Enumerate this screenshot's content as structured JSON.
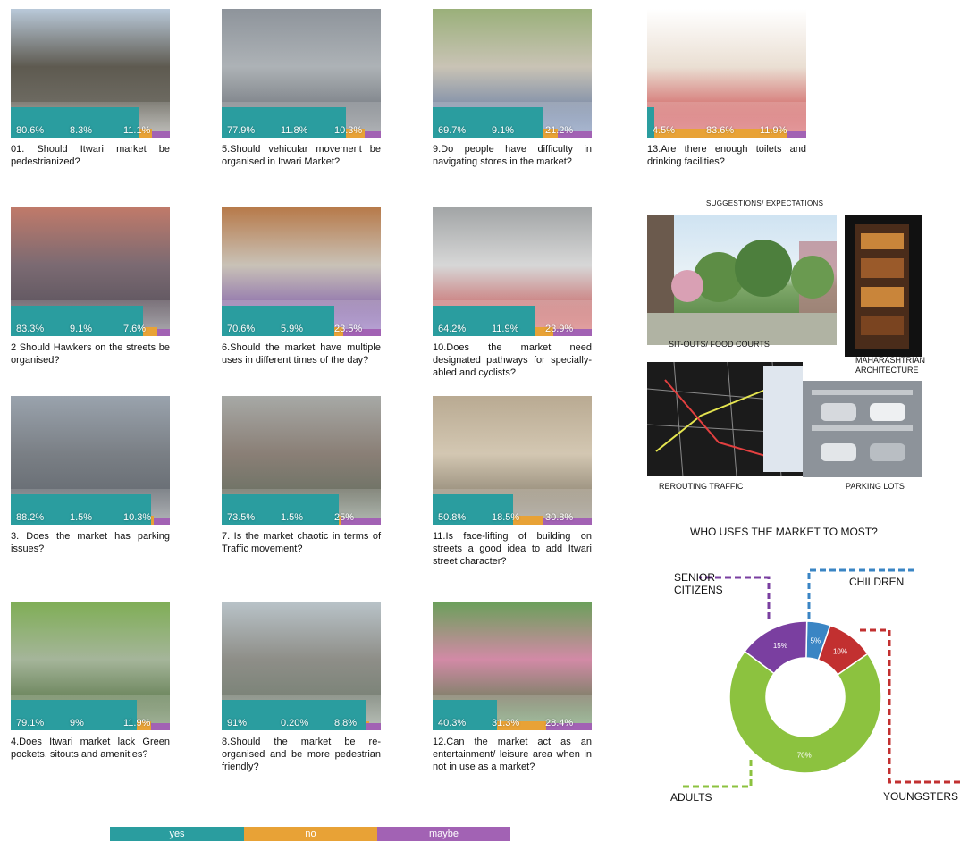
{
  "colors": {
    "yes": "#2a9d9f",
    "no": "#e8a236",
    "maybe": "#a262b4",
    "senior": "#7a3fa0",
    "children": "#3a85c4",
    "youngsters": "#c23030",
    "adults": "#8cc23f"
  },
  "questions": [
    {
      "id": "q1",
      "text": "01. Should Itwari market be pedestrianized?",
      "yes": 80.6,
      "no": 8.3,
      "maybe": 11.1,
      "labels": [
        "80.6%",
        "8.3%",
        "11.1%"
      ]
    },
    {
      "id": "q2",
      "text": "2 Should Hawkers on the streets be organised?",
      "yes": 83.3,
      "no": 9.1,
      "maybe": 7.6,
      "labels": [
        "83.3%",
        "9.1%",
        "7.6%"
      ]
    },
    {
      "id": "q3",
      "text": "3. Does the market has parking issues?",
      "yes": 88.2,
      "no": 1.5,
      "maybe": 10.3,
      "labels": [
        "88.2%",
        "1.5%",
        "10.3%"
      ]
    },
    {
      "id": "q4",
      "text": "4.Does Itwari market lack Green pockets, sitouts and amenities?",
      "yes": 79.1,
      "no": 9,
      "maybe": 11.9,
      "labels": [
        "79.1%",
        "9%",
        "11.9%"
      ]
    },
    {
      "id": "q5",
      "text": "5.Should vehicular movement be organised in Itwari Market?",
      "yes": 77.9,
      "no": 11.8,
      "maybe": 10.3,
      "labels": [
        "77.9%",
        "11.8%",
        "10.3%"
      ]
    },
    {
      "id": "q6",
      "text": "6.Should the market have multiple uses in different times of the day?",
      "yes": 70.6,
      "no": 5.9,
      "maybe": 23.5,
      "labels": [
        "70.6%",
        "5.9%",
        "23.5%"
      ]
    },
    {
      "id": "q7",
      "text": "7. Is the market chaotic in terms of Traffic movement?",
      "yes": 73.5,
      "no": 1.5,
      "maybe": 25,
      "labels": [
        "73.5%",
        "1.5%",
        "25%"
      ]
    },
    {
      "id": "q8",
      "text": "8.Should the market be re-organised and be more pedestrian friendly?",
      "yes": 91,
      "no": 0.2,
      "maybe": 8.8,
      "labels": [
        "91%",
        "0.20%",
        "8.8%"
      ]
    },
    {
      "id": "q9",
      "text": "9.Do people have difficulty in navigating stores in the market?",
      "yes": 69.7,
      "no": 9.1,
      "maybe": 21.2,
      "labels": [
        "69.7%",
        "9.1%",
        "21.2%"
      ]
    },
    {
      "id": "q10",
      "text": "10.Does the market need designated pathways for specially-abled and cyclists?",
      "yes": 64.2,
      "no": 11.9,
      "maybe": 23.9,
      "labels": [
        "64.2%",
        "11.9%",
        "23.9%"
      ]
    },
    {
      "id": "q11",
      "text": "11.Is face-lifting of building on streets a good idea to add Itwari street character?",
      "yes": 50.8,
      "no": 18.5,
      "maybe": 30.8,
      "labels": [
        "50.8%",
        "18.5%",
        "30.8%"
      ]
    },
    {
      "id": "q12",
      "text": "12.Can the market act as an entertainment/ leisure area when in not in use as a market?",
      "yes": 40.3,
      "no": 31.3,
      "maybe": 28.4,
      "labels": [
        "40.3%",
        "31.3%",
        "28.4%"
      ]
    },
    {
      "id": "q13",
      "text": "13.Are there enough toilets and drinking facilities?",
      "yes": 4.5,
      "no": 83.6,
      "maybe": 11.9,
      "labels": [
        "4.5%",
        "83.6%",
        "11.9%"
      ]
    }
  ],
  "suggestions": {
    "title": "SUGGESTIONS/ EXPECTATIONS",
    "sitouts": "SIT-OUTS/ FOOD COURTS",
    "architecture": "MAHARASHTRIAN ARCHITECTURE",
    "traffic": "REROUTING TRAFFIC",
    "parking": "PARKING LOTS"
  },
  "legend": {
    "yes": "yes",
    "no": "no",
    "maybe": "maybe"
  },
  "chart_data": [
    {
      "type": "bar",
      "stacked": true,
      "categories": [
        "01",
        "2",
        "3",
        "4",
        "5",
        "6",
        "7",
        "8",
        "9",
        "10",
        "11",
        "12",
        "13"
      ],
      "series": [
        {
          "name": "yes",
          "values": [
            80.6,
            83.3,
            88.2,
            79.1,
            77.9,
            70.6,
            73.5,
            91,
            69.7,
            64.2,
            50.8,
            40.3,
            4.5
          ]
        },
        {
          "name": "no",
          "values": [
            8.3,
            9.1,
            1.5,
            9,
            11.8,
            5.9,
            1.5,
            0.2,
            9.1,
            11.9,
            18.5,
            31.3,
            83.6
          ]
        },
        {
          "name": "maybe",
          "values": [
            11.1,
            7.6,
            10.3,
            11.9,
            10.3,
            23.5,
            25,
            8.8,
            21.2,
            23.9,
            30.8,
            28.4,
            11.9
          ]
        }
      ]
    },
    {
      "type": "pie",
      "donut": true,
      "title": "WHO USES THE MARKET TO MOST?",
      "slices": [
        {
          "name": "CHILDREN",
          "value": 5,
          "label": "5%"
        },
        {
          "name": "YOUNGSTERS",
          "value": 10,
          "label": "10%"
        },
        {
          "name": "ADULTS",
          "value": 70,
          "label": "70%"
        },
        {
          "name": "SENIOR CITIZENS",
          "value": 15,
          "label": "15%"
        }
      ]
    }
  ]
}
